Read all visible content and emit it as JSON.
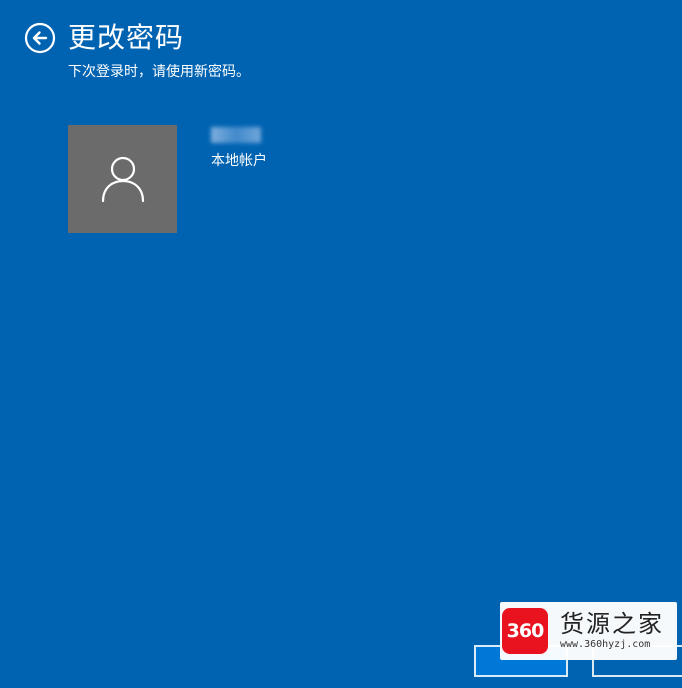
{
  "header": {
    "title": "更改密码",
    "subtitle": "下次登录时，请使用新密码。"
  },
  "account": {
    "type_label": "本地帐户"
  },
  "footer": {
    "primary_label": "",
    "secondary_label": ""
  },
  "watermark": {
    "logo_text": "360",
    "name": "货源之家",
    "url": "www.360hyzj.com"
  },
  "colors": {
    "background": "#0063b1",
    "avatar_tile": "#6b6b6b",
    "watermark_logo": "#e8131f"
  }
}
